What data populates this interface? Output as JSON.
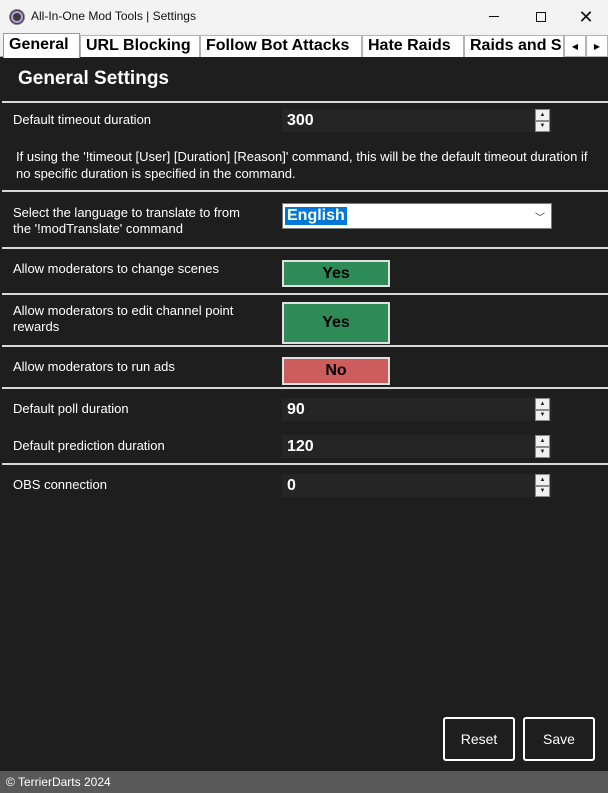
{
  "window": {
    "title": "All-In-One Mod Tools | Settings",
    "icon": "app-logo-icon",
    "controls": {
      "minimize": "minimize-icon",
      "maximize": "maximize-icon",
      "close": "✕"
    }
  },
  "tabs": [
    {
      "label": "General",
      "active": true
    },
    {
      "label": "URL Blocking",
      "active": false
    },
    {
      "label": "Follow Bot Attacks",
      "active": false
    },
    {
      "label": "Hate Raids",
      "active": false
    },
    {
      "label": "Raids and S",
      "active": false
    }
  ],
  "tab_scroll": {
    "left": "◀",
    "right": "▶"
  },
  "page": {
    "heading": "General Settings",
    "timeout": {
      "label": "Default timeout duration",
      "value": "300",
      "description": "If using the '!timeout [User] [Duration] [Reason]' command, this will be the default timeout duration if no specific duration is specified in the command."
    },
    "language": {
      "label_line1": "Select the language to translate to from",
      "label_line2": "the '!modTranslate' command",
      "value": "English"
    },
    "scenes": {
      "label": "Allow moderators to change scenes",
      "value": "Yes"
    },
    "rewards": {
      "label_line1": "Allow moderators to edit channel point",
      "label_line2": "rewards",
      "value": "Yes"
    },
    "ads": {
      "label": "Allow moderators to run ads",
      "value": "No"
    },
    "poll": {
      "label": "Default poll duration",
      "value": "90"
    },
    "prediction": {
      "label": "Default prediction duration",
      "value": "120"
    },
    "obs": {
      "label": "OBS connection",
      "value": "0"
    }
  },
  "buttons": {
    "reset": "Reset",
    "save": "Save"
  },
  "footer": {
    "text": "© TerrierDarts 2024"
  },
  "colors": {
    "yes": "#2e8b57",
    "no": "#cd5c5c",
    "background": "#1e1e1e",
    "selection": "#0078d7"
  }
}
